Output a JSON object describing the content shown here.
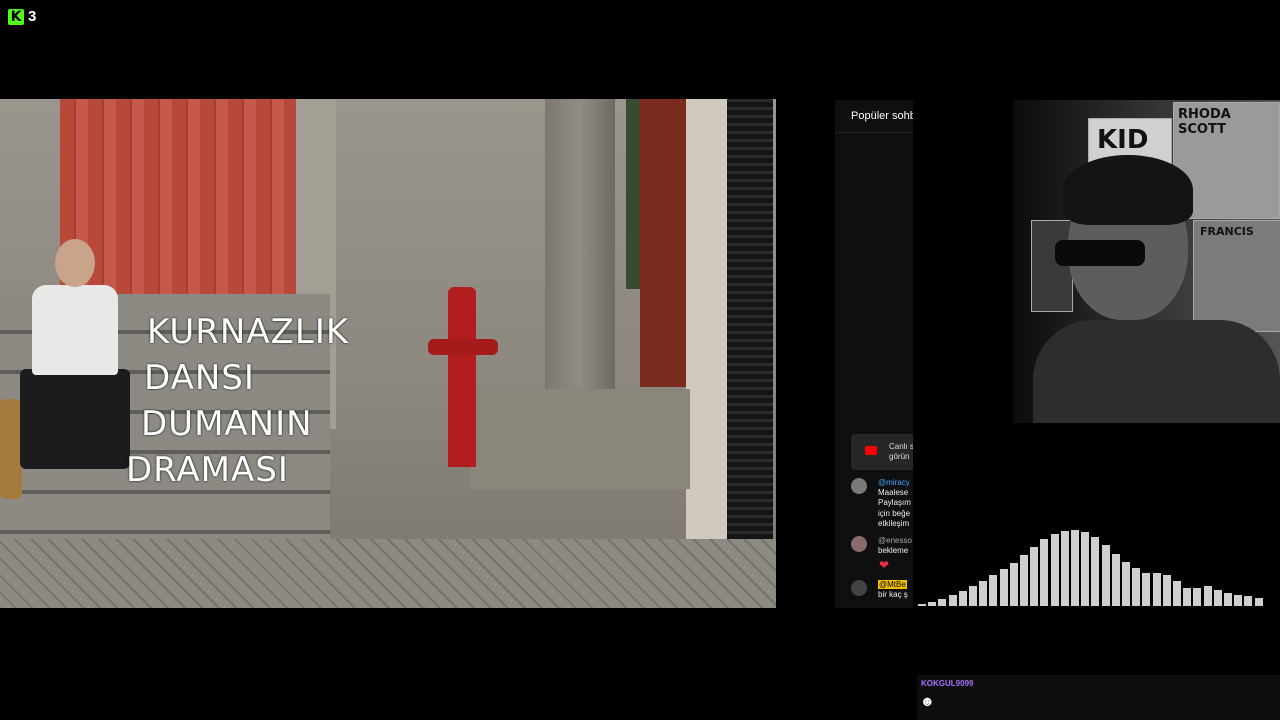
{
  "app": {
    "logo_letter": "K",
    "viewer_count": "3",
    "brand_color": "#53fc18"
  },
  "video": {
    "overlay_lines": [
      "KURNAZLIK",
      "DANSI",
      "DUMANIN",
      "DRAMASI"
    ]
  },
  "chat": {
    "title": "Popüler sohb",
    "notice": {
      "icon": "youtube-icon",
      "text": "Canlı s\ngörün"
    },
    "messages": [
      {
        "user": "@miracy",
        "text": "Maalese\nPaylaşım\niçin beğe\netkileşim"
      },
      {
        "user": "@enesso",
        "text": "bekleme",
        "emote": "❤"
      },
      {
        "mention": "@MtBe",
        "text": "bir kaç ş"
      }
    ]
  },
  "webcam": {
    "posters": [
      "RHODA SCOTT",
      "KID",
      "FRANCIS"
    ]
  },
  "visualizer": {
    "levels": [
      0.02,
      0.05,
      0.08,
      0.14,
      0.18,
      0.24,
      0.3,
      0.38,
      0.45,
      0.52,
      0.62,
      0.72,
      0.82,
      0.88,
      0.92,
      0.93,
      0.9,
      0.84,
      0.74,
      0.64,
      0.54,
      0.46,
      0.4,
      0.4,
      0.38,
      0.3,
      0.22,
      0.22,
      0.24,
      0.2,
      0.16,
      0.14,
      0.12,
      0.1
    ]
  },
  "bottom_chat": {
    "user": "KOKGUL9099",
    "emote": "☻"
  }
}
